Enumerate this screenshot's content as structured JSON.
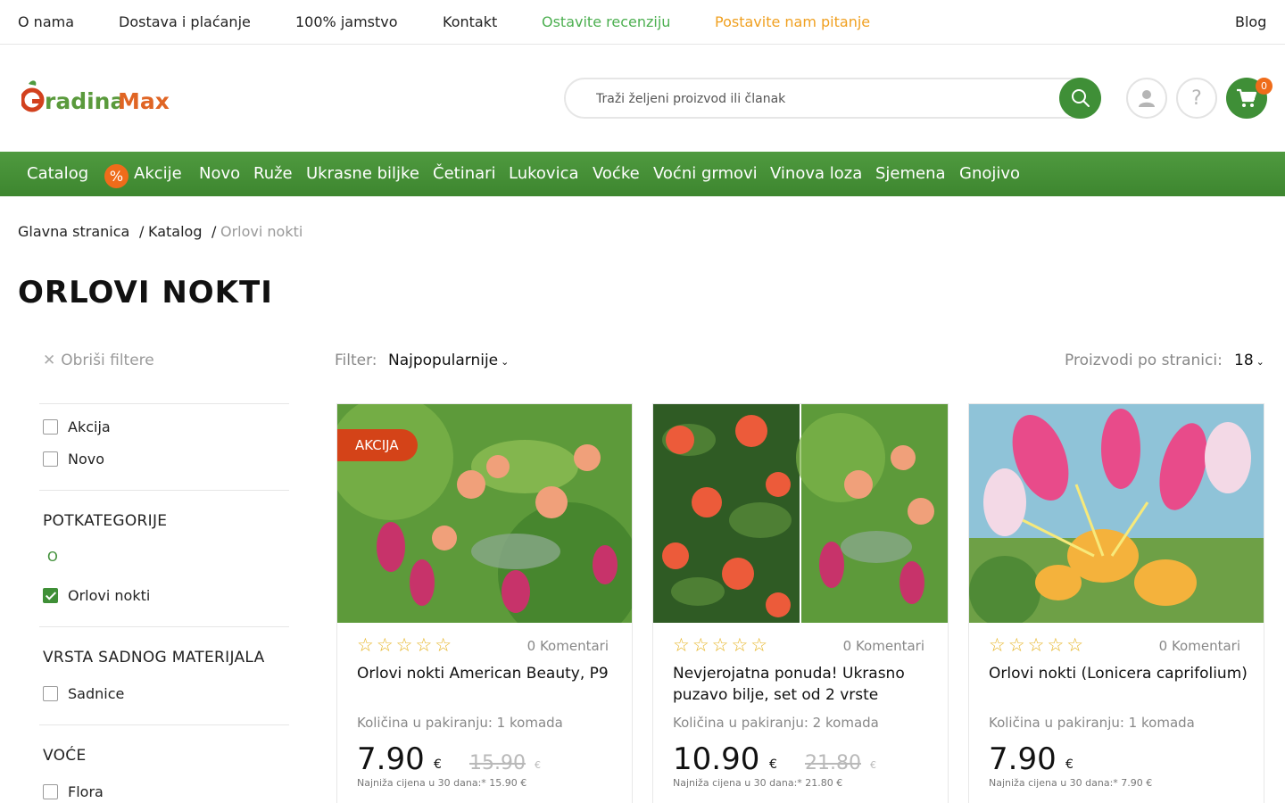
{
  "topbar": {
    "links": [
      {
        "label": "O nama",
        "color": "#222222"
      },
      {
        "label": "Dostava i plaćanje",
        "color": "#222222"
      },
      {
        "label": "100% jamstvo",
        "color": "#222222"
      },
      {
        "label": "Kontakt",
        "color": "#222222"
      },
      {
        "label": "Ostavite recenziju",
        "color": "#4caf50"
      },
      {
        "label": "Postavite nam pitanje",
        "color": "#f0a020"
      }
    ],
    "blog": "Blog"
  },
  "header": {
    "logo": {
      "prefix": "G",
      "mid": "radina",
      "suffix": "Max"
    },
    "search_placeholder": "Traži željeni proizvod ili članak",
    "cart_count": "0",
    "brand_green": "#3f8f37",
    "accent_orange": "#ef6c1a"
  },
  "nav": {
    "catalog": "Catalog",
    "sale_icon": "%",
    "items": [
      "Akcije",
      "Novo",
      "Ruže",
      "Ukrasne biljke",
      "Četinari",
      "Lukovica",
      "Voćke",
      "Voćni grmovi",
      "Vinova loza",
      "Sjemena",
      "Gnojivo"
    ]
  },
  "breadcrumb": {
    "home": "Glavna stranica",
    "catalog": "Katalog",
    "current": "Orlovi nokti",
    "sep": "/"
  },
  "page_title": "ORLOVI NOKTI",
  "sidebar": {
    "clear_filters": "Obriši filtere",
    "flags": [
      {
        "label": "Akcija",
        "checked": false
      },
      {
        "label": "Novo",
        "checked": false
      }
    ],
    "subcategories_title": "POTKATEGORIJE",
    "letter": "O",
    "subcategories": [
      {
        "label": "Orlovi nokti",
        "checked": true
      }
    ],
    "material_title": "VRSTA SADNOG MATERIJALA",
    "materials": [
      {
        "label": "Sadnice",
        "checked": false
      }
    ],
    "fruit_title": "VOĆE",
    "fruits": [
      {
        "label": "Flora",
        "checked": false
      }
    ]
  },
  "sortbar": {
    "filter_label": "Filter:",
    "filter_value": "Najpopularnije",
    "per_page_label": "Proizvodi po stranici:",
    "per_page_value": "18"
  },
  "products": [
    {
      "badge": "AKCIJA",
      "rating": 0,
      "comments": "0 Komentari",
      "name": "Orlovi nokti American Beauty, P9",
      "pack": "Količina u pakiranju: 1 komada",
      "price": "7.90",
      "currency": "€",
      "old_price": "15.90",
      "lowest": "Najniža cijena u 30 dana:* 15.90 €"
    },
    {
      "badge": "",
      "rating": 0,
      "comments": "0 Komentari",
      "name": "Nevjerojatna ponuda! Ukrasno puzavo bilje, set od 2 vrste",
      "pack": "Količina u pakiranju: 2 komada",
      "price": "10.90",
      "currency": "€",
      "old_price": "21.80",
      "lowest": "Najniža cijena u 30 dana:* 21.80 €"
    },
    {
      "badge": "",
      "rating": 0,
      "comments": "0 Komentari",
      "name": "Orlovi nokti (Lonicera caprifolium)",
      "pack": "Količina u pakiranju: 1 komada",
      "price": "7.90",
      "currency": "€",
      "old_price": "",
      "lowest": "Najniža cijena u 30 dana:* 7.90 €"
    }
  ]
}
